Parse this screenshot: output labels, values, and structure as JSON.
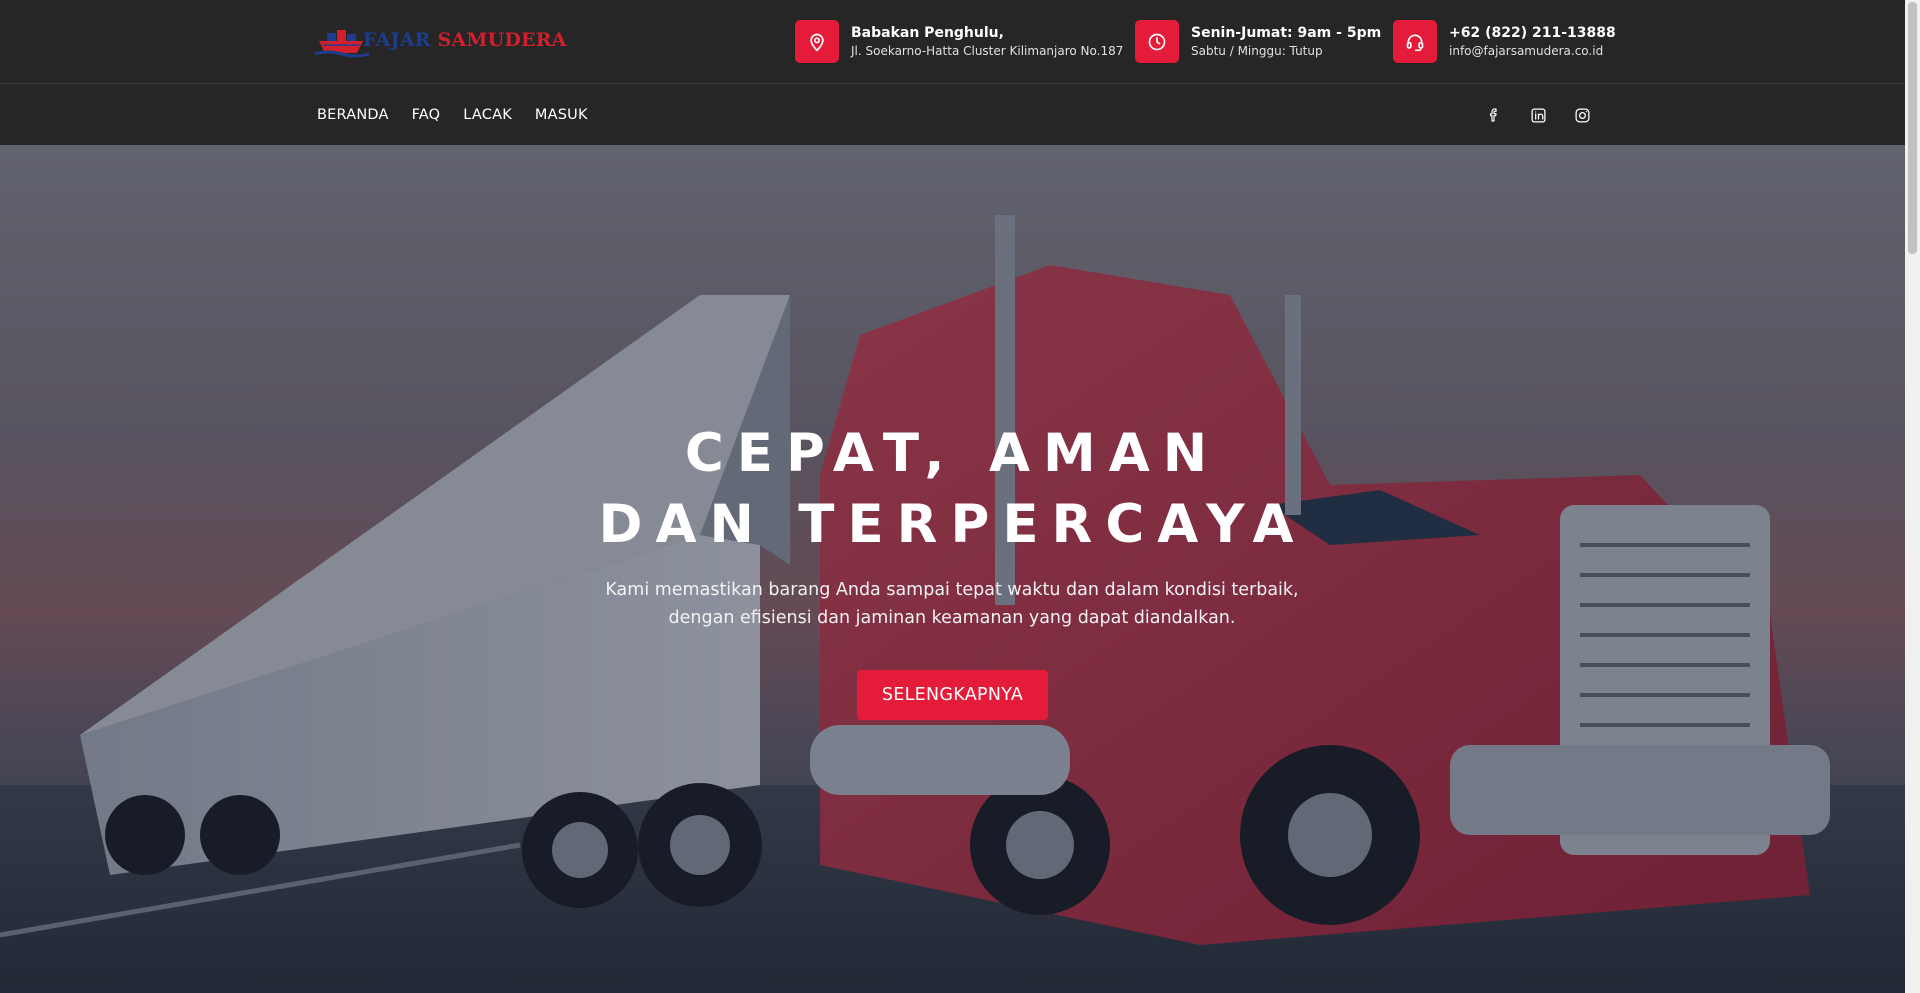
{
  "brand": {
    "name_part1": "FAJAR",
    "name_part2": "SAMUDERA",
    "logo_icon": "ship-icon"
  },
  "contact": {
    "address": {
      "icon": "map-pin-icon",
      "title": "Babakan Penghulu,",
      "sub": "Jl. Soekarno-Hatta Cluster Kilimanjaro No.187"
    },
    "hours": {
      "icon": "clock-icon",
      "title": "Senin-Jumat: 9am - 5pm",
      "sub": "Sabtu / Minggu: Tutup"
    },
    "phone": {
      "icon": "headset-icon",
      "title": "+62 (822) 211-13888",
      "sub": "info@fajarsamudera.co.id"
    }
  },
  "nav": {
    "items": [
      {
        "label": "BERANDA"
      },
      {
        "label": "FAQ"
      },
      {
        "label": "LACAK"
      },
      {
        "label": "MASUK"
      }
    ]
  },
  "social": [
    "facebook-icon",
    "linkedin-icon",
    "instagram-icon"
  ],
  "hero": {
    "title_line1": "CEPAT, AMAN",
    "title_line2": "DAN TERPERCAYA",
    "description": "Kami memastikan barang Anda sampai tepat waktu dan dalam kondisi terbaik, dengan efisiensi dan jaminan keamanan yang dapat diandalkan.",
    "button_label": "SELENGKAPNYA"
  },
  "colors": {
    "accent": "#e41c3a",
    "bar_bg": "#262626",
    "brand_blue": "#1e3d8f",
    "brand_red": "#d21f2e"
  }
}
